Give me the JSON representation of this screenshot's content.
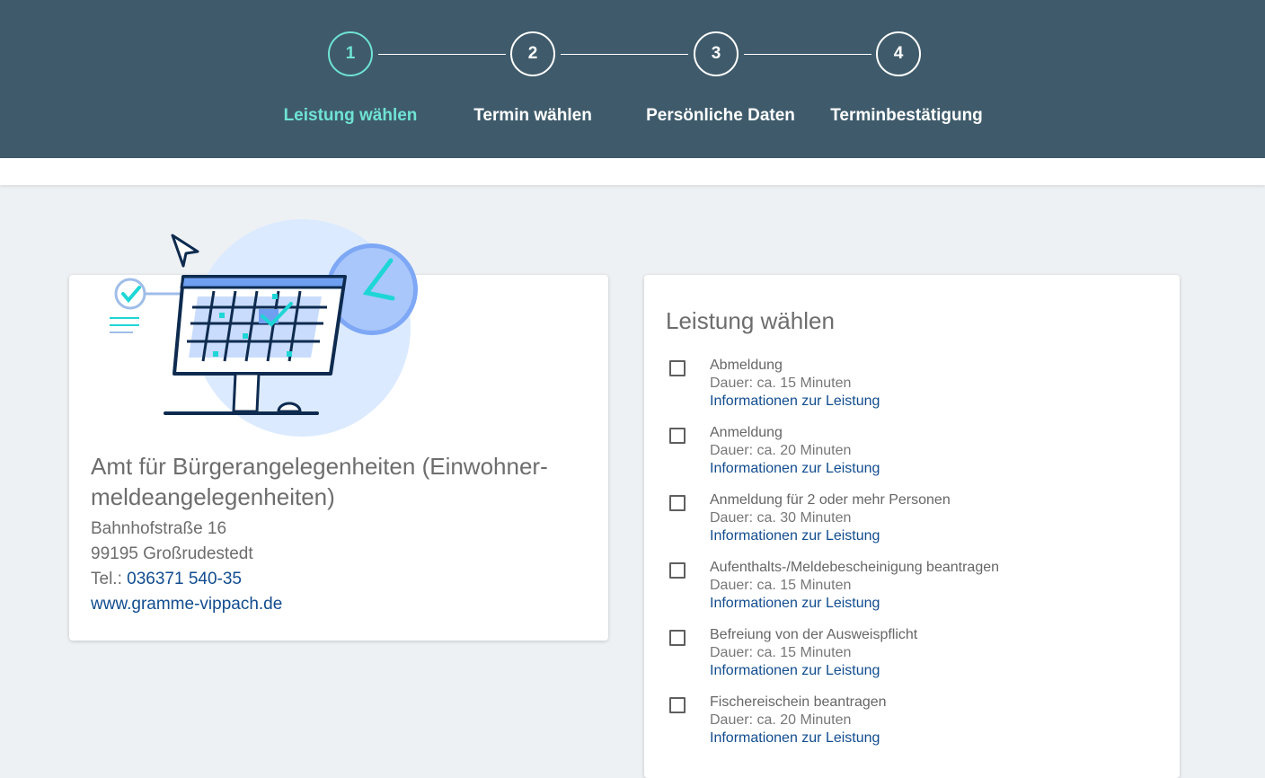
{
  "steps": [
    {
      "number": "1",
      "label": "Leistung wählen"
    },
    {
      "number": "2",
      "label": "Termin wählen"
    },
    {
      "number": "3",
      "label": "Persönliche Daten"
    },
    {
      "number": "4",
      "label": "Terminbestätigung"
    }
  ],
  "colors": {
    "header": "#3f5b6b",
    "active_step": "#6fe3d3",
    "link": "#114c8f"
  },
  "office": {
    "illustration_icon": "calendar-monitor-illustration",
    "name": "Amt für Bürgerangelegenheiten (Einwohner-meldeangelegenheiten)",
    "street": "Bahnhofstraße 16",
    "city": "99195 Großrudestedt",
    "phone_label": "Tel.:",
    "phone": "036371 540-35",
    "website": "www.gramme-vippach.de"
  },
  "services": {
    "heading": "Leistung wählen",
    "items": [
      {
        "name": "Abmeldung",
        "duration": "Dauer: ca. 15 Minuten",
        "info_link": "Informationen zur Leistung"
      },
      {
        "name": "Anmeldung",
        "duration": "Dauer: ca. 20 Minuten",
        "info_link": "Informationen zur Leistung"
      },
      {
        "name": "Anmeldung für 2 oder mehr Personen",
        "duration": "Dauer: ca. 30 Minuten",
        "info_link": "Informationen zur Leistung"
      },
      {
        "name": "Aufenthalts-/Meldebescheinigung beantragen",
        "duration": "Dauer: ca. 15 Minuten",
        "info_link": "Informationen zur Leistung"
      },
      {
        "name": "Befreiung von der Ausweispflicht",
        "duration": "Dauer: ca. 15 Minuten",
        "info_link": "Informationen zur Leistung"
      },
      {
        "name": "Fischereischein beantragen",
        "duration": "Dauer: ca. 20 Minuten",
        "info_link": "Informationen zur Leistung"
      }
    ]
  }
}
